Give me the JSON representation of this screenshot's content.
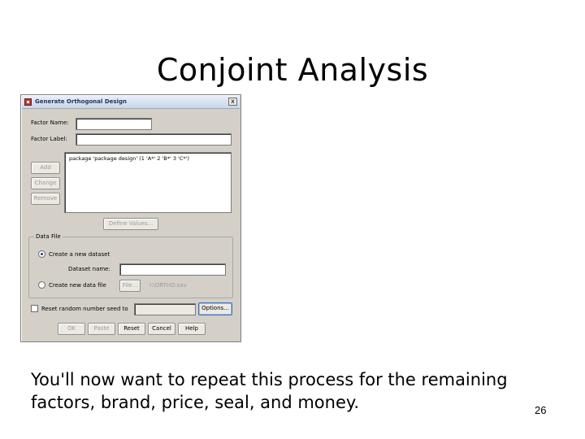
{
  "slide": {
    "title": "Conjoint Analysis",
    "body": "You'll now want to repeat this process for the remaining factors, brand, price, seal, and money.",
    "page_number": "26"
  },
  "dialog": {
    "title": "Generate Orthogonal Design",
    "close_glyph": "x",
    "factor_name_label": "Factor Name:",
    "factor_name_value": "",
    "factor_label_label": "Factor Label:",
    "factor_label_value": "",
    "factor_list": [
      "package 'package design' (1 'A*' 2 'B*' 3 'C*')"
    ],
    "add_label": "Add",
    "change_label": "Change",
    "remove_label": "Remove",
    "define_values_label": "Define Values...",
    "data_file": {
      "legend": "Data File",
      "create_new_dataset_label": "Create a new dataset",
      "create_new_dataset_selected": true,
      "dataset_name_label": "Dataset name:",
      "dataset_name_value": "",
      "create_new_data_file_label": "Create new data file",
      "file_button_label": "File...",
      "file_path": "I:\\ORTHO.sav"
    },
    "reset_seed_label": "Reset random number seed to",
    "reset_seed_checked": false,
    "seed_value": "",
    "options_label": "Options...",
    "ok_label": "OK",
    "paste_label": "Paste",
    "reset_label": "Reset",
    "cancel_label": "Cancel",
    "help_label": "Help"
  }
}
